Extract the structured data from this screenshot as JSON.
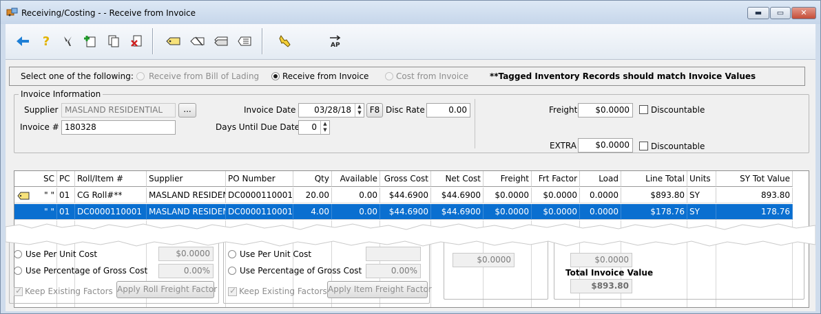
{
  "window": {
    "title": "Receiving/Costing - - Receive from Invoice",
    "controls": {
      "minimize": "▬",
      "maximize": "▭",
      "close": "✕"
    }
  },
  "toolbar": {
    "buttons": [
      {
        "name": "back-arrow-icon",
        "color": "#1e7fd6"
      },
      {
        "name": "help-question-icon",
        "color": "#e2b300"
      },
      {
        "name": "tools-icon",
        "color": "#444444"
      },
      {
        "name": "add-document-icon",
        "color": "#1f9a2a"
      },
      {
        "name": "copy-document-icon",
        "color": "#444444"
      },
      {
        "name": "delete-document-icon",
        "color": "#d02020"
      },
      {
        "name": "tag-icon",
        "color": "#444444"
      },
      {
        "name": "remove-tag-icon",
        "color": "#444444"
      },
      {
        "name": "tags-icon",
        "color": "#444444"
      },
      {
        "name": "tags-list-icon",
        "color": "#444444"
      },
      {
        "name": "apply-hand-icon",
        "color": "#d9a900"
      },
      {
        "name": "ap-transfer-icon",
        "label": "AP",
        "color": "#222222"
      }
    ]
  },
  "selection": {
    "prompt": "Select one of the following:",
    "options": [
      {
        "label": "Receive from Bill of Lading",
        "selected": false,
        "enabled": false
      },
      {
        "label": "Receive from Invoice",
        "selected": true,
        "enabled": true
      },
      {
        "label": "Cost from Invoice",
        "selected": false,
        "enabled": false
      }
    ],
    "note": "**Tagged Inventory Records should match Invoice Values"
  },
  "invoice": {
    "group_title": "Invoice Information",
    "supplier_label": "Supplier",
    "supplier_value": "MASLAND RESIDENTIAL",
    "browse_label": "...",
    "invoice_no_label": "Invoice #",
    "invoice_no_value": "180328",
    "invoice_date_label": "Invoice Date",
    "invoice_date_value": "03/28/18",
    "f8_label": "F8",
    "disc_rate_label": "Disc Rate",
    "disc_rate_value": "0.00",
    "days_due_label": "Days Until Due Date",
    "days_due_value": "0",
    "freight_label": "Freight",
    "freight_value": "$0.0000",
    "freight_discountable_label": "Discountable",
    "freight_discountable": false,
    "extra_label": "EXTRA",
    "extra_value": "$0.0000",
    "extra_discountable_label": "Discountable",
    "extra_discountable": false
  },
  "grid": {
    "columns": [
      "SC",
      "PC",
      "Roll/Item #",
      "Supplier",
      "PO Number",
      "Qty",
      "Available",
      "Gross Cost",
      "Net Cost",
      "Freight",
      "Frt Factor",
      "Load",
      "Line Total",
      "Units",
      "SY Tot Value"
    ],
    "rows": [
      {
        "sc": "\" \"",
        "pc": "01",
        "item": "CG Roll#**",
        "supplier": "MASLAND RESIDENT",
        "po": "DC0000110001",
        "qty": "20.00",
        "available": "0.00",
        "gross": "$44.6900",
        "net": "$44.6900",
        "freight": "$0.0000",
        "frt_factor": "$0.0000",
        "load": "0.0000",
        "line_total": "$893.80",
        "units": "SY",
        "sy_tot": "893.80",
        "tagged": true,
        "selected": false
      },
      {
        "sc": "\" \"",
        "pc": "01",
        "item": "DC0000110001",
        "supplier": "MASLAND RESIDENT",
        "po": "DC0000110001",
        "qty": "4.00",
        "available": "0.00",
        "gross": "$44.6900",
        "net": "$44.6900",
        "freight": "$0.0000",
        "frt_factor": "$0.0000",
        "load": "0.0000",
        "line_total": "$178.76",
        "units": "SY",
        "sy_tot": "178.76",
        "tagged": false,
        "selected": true
      }
    ],
    "selection_color": "#0a6fd0"
  },
  "roll_freight": {
    "per_unit_label": "Use Per Unit Cost",
    "per_unit_value": "$0.0000",
    "pct_label": "Use Percentage of Gross Cost",
    "pct_value": "0.00%",
    "keep_label": "Keep Existing Factors",
    "keep_checked": true,
    "apply_label": "Apply Roll Freight Factor"
  },
  "item_freight": {
    "per_unit_label": "Use Per Unit Cost",
    "pct_label": "Use Percentage of Gross Cost",
    "pct_value": "0.00%",
    "keep_label": "Keep Existing Factors",
    "keep_checked": true,
    "apply_label": "Apply Item Freight Factor"
  },
  "totals": {
    "left_value": "$0.0000",
    "upper_value": "$0.0000",
    "total_label": "Total Invoice Value",
    "total_value": "$893.80"
  }
}
